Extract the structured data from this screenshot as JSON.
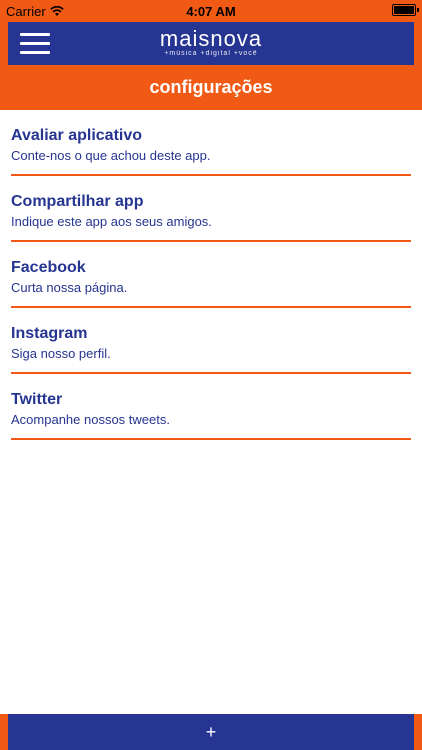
{
  "status_bar": {
    "carrier": "Carrier",
    "time": "4:07 AM",
    "wifi_icon": "wifi-icon",
    "battery_icon": "battery-icon"
  },
  "header": {
    "menu_icon": "hamburger-menu-icon",
    "logo_text": "maisnova",
    "logo_tagline": "+música +digital +você",
    "page_title": "configurações"
  },
  "settings": [
    {
      "title": "Avaliar aplicativo",
      "subtitle": "Conte-nos o que achou deste app."
    },
    {
      "title": "Compartilhar app",
      "subtitle": "Indique este app aos seus amigos."
    },
    {
      "title": "Facebook",
      "subtitle": "Curta nossa página."
    },
    {
      "title": "Instagram",
      "subtitle": "Siga nosso perfil."
    },
    {
      "title": "Twitter",
      "subtitle": "Acompanhe nossos tweets."
    }
  ],
  "bottom_bar": {
    "label": "+"
  },
  "colors": {
    "brand_orange": "#f05a14",
    "brand_blue": "#263591"
  }
}
